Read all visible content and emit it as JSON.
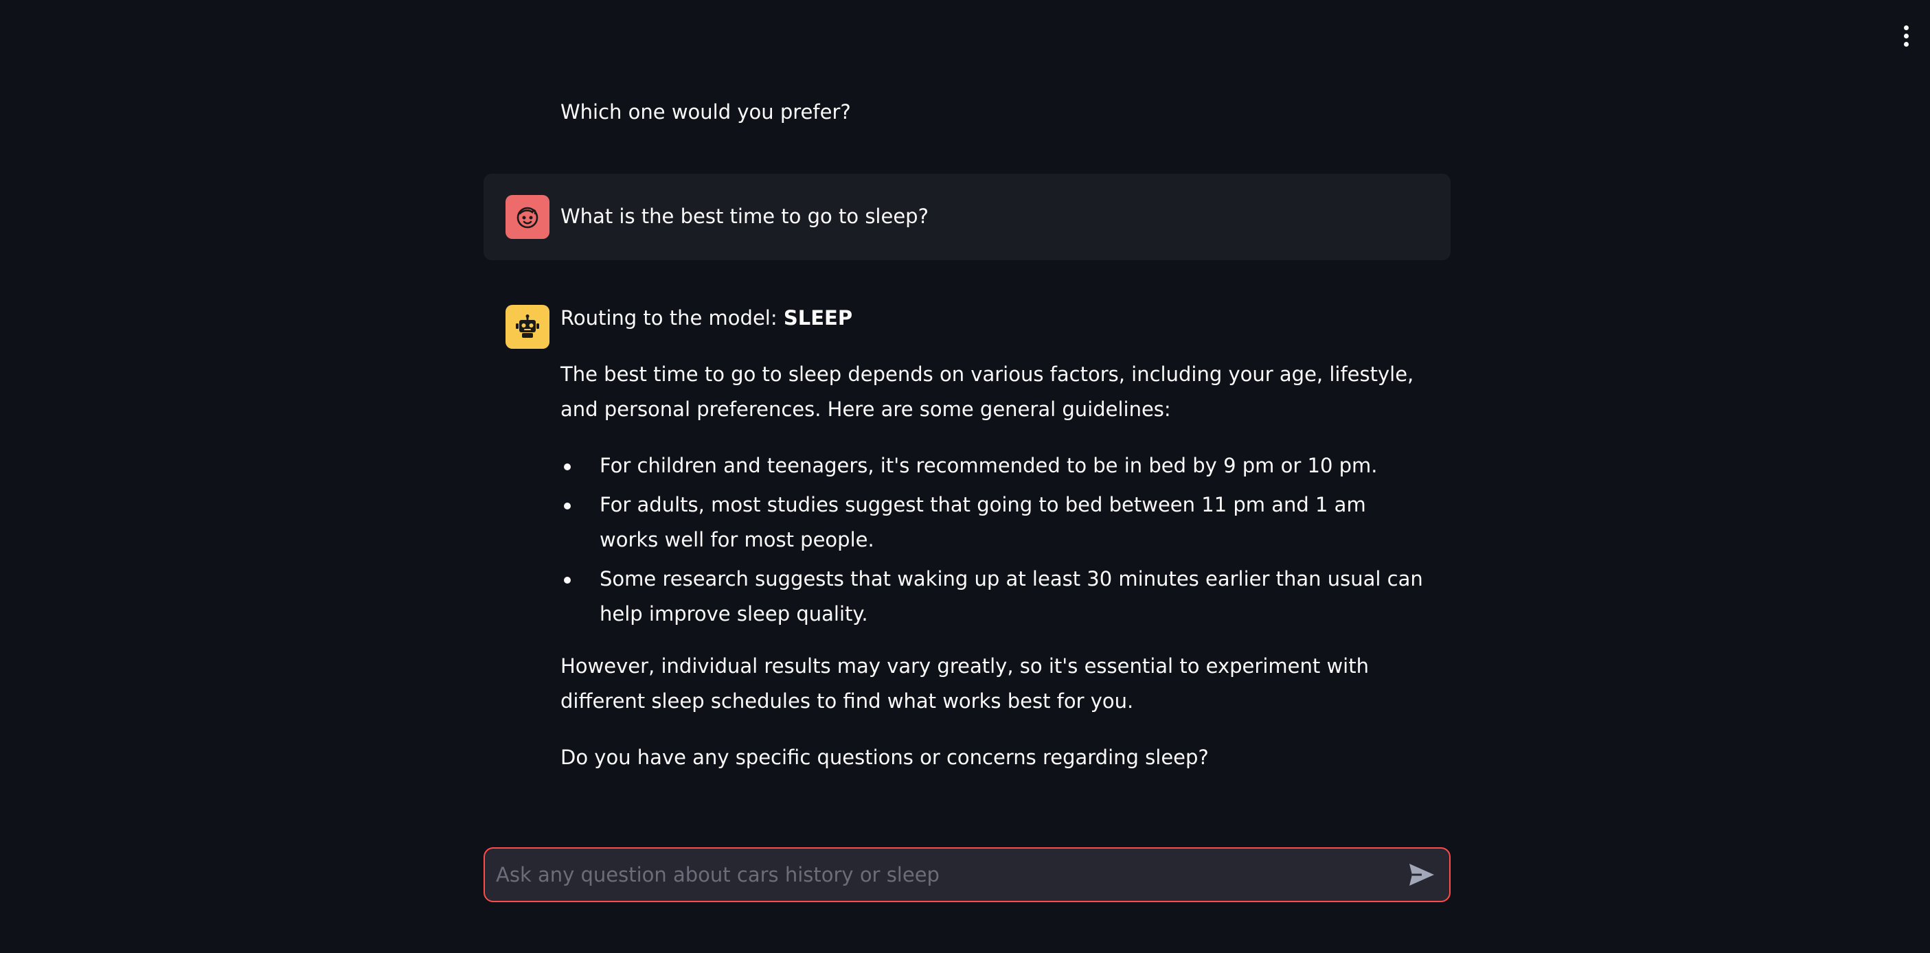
{
  "chat": {
    "previous_message_tail": "Which one would you prefer?",
    "user_message": {
      "avatar_icon": "user-face-icon",
      "avatar_color": "#ee6b6b",
      "text": "What is the best time to go to sleep?"
    },
    "assistant_message": {
      "avatar_icon": "robot-icon",
      "avatar_color": "#f9c94e",
      "routing_prefix": "Routing to the model: ",
      "routing_model": "SLEEP",
      "intro": "The best time to go to sleep depends on various factors, including your age, lifestyle, and personal preferences. Here are some general guidelines:",
      "guidelines": [
        "For children and teenagers, it's recommended to be in bed by 9 pm or 10 pm.",
        "For adults, most studies suggest that going to bed between 11 pm and 1 am works well for most people.",
        "Some research suggests that waking up at least 30 minutes earlier than usual can help improve sleep quality."
      ],
      "conclusion": "However, individual results may vary greatly, so it's essential to experiment with different sleep schedules to find what works best for you.",
      "followup": "Do you have any specific questions or concerns regarding sleep?"
    }
  },
  "input": {
    "placeholder": "Ask any question about cars history or sleep",
    "value": "",
    "send_icon": "send-icon",
    "border_color": "#ff4b4b"
  },
  "header": {
    "menu_icon": "kebab-menu-icon"
  },
  "colors": {
    "background": "#0e1117",
    "user_bubble": "#1a1c24",
    "text": "#fafafa"
  }
}
